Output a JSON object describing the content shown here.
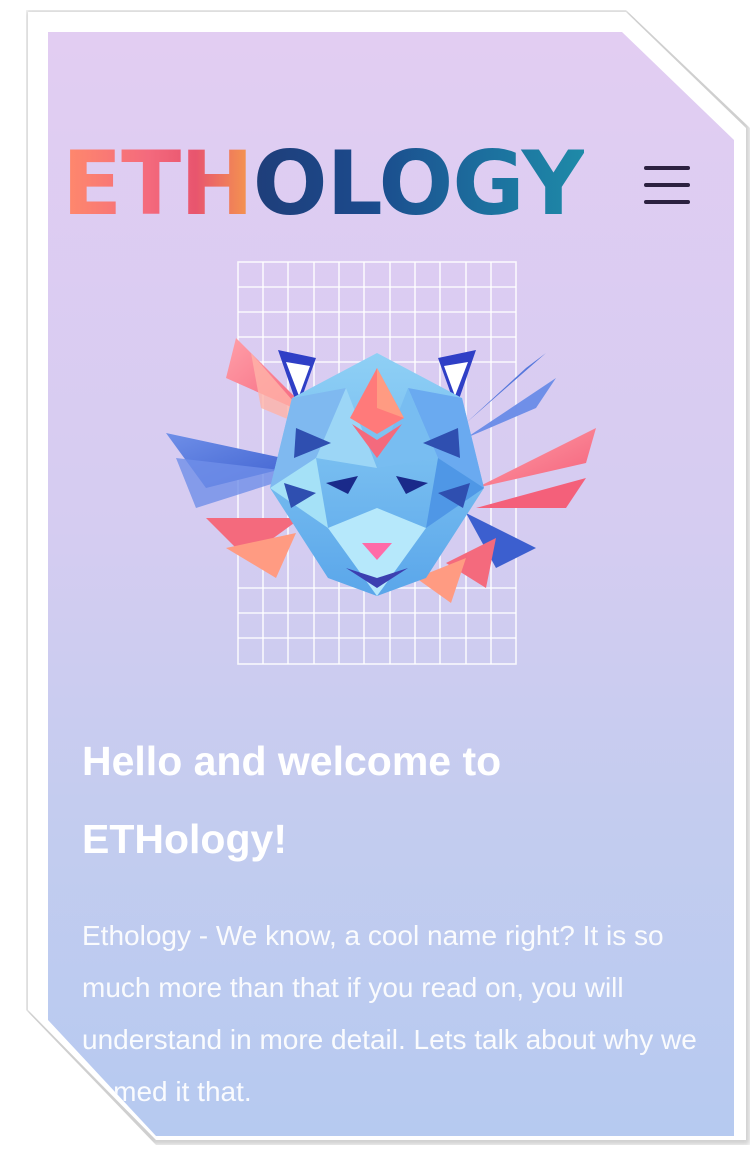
{
  "header": {
    "logo_part_warm": "ETH",
    "logo_part_cool": "OLOGY",
    "menu_icon": "hamburger-menu-icon"
  },
  "hero": {
    "illustration": "low-poly-tiger-head-with-ethereum-diamond-and-palm-leaves",
    "grid_icon": "grid-pattern"
  },
  "content": {
    "headline": "Hello and welcome to ETHology!",
    "intro": "Ethology - We know, a cool name right? It is so much more than that if you read on, you will understand in more detail. Lets talk about why we named it that."
  },
  "colors": {
    "background_top": "#e2cdf2",
    "background_bottom": "#b6caf0",
    "logo_warm": "#f46a7d",
    "logo_cool": "#1b4a8c",
    "menu_icon": "#2c2140",
    "text": "#ffffff"
  }
}
